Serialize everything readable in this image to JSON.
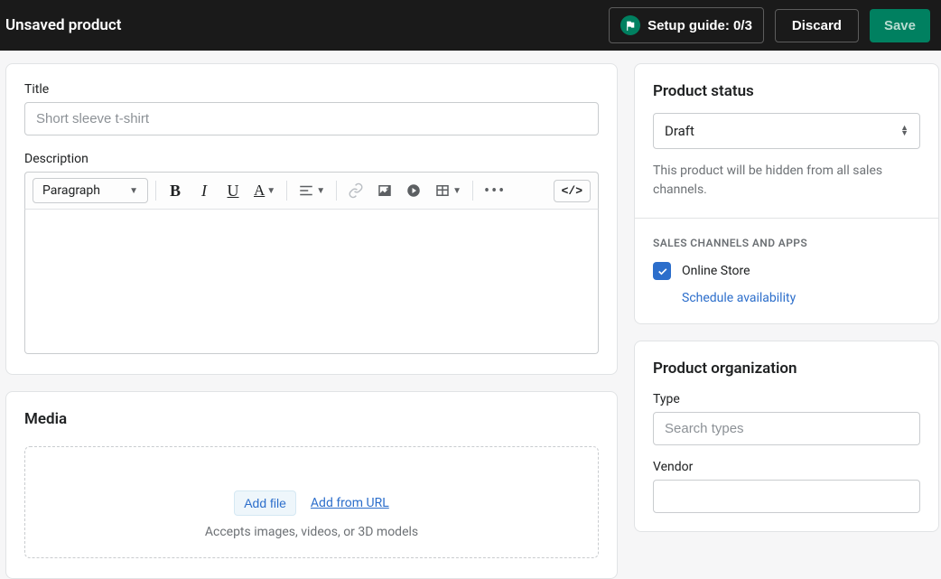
{
  "topbar": {
    "title": "Unsaved product",
    "setup_guide": "Setup guide: 0/3",
    "discard": "Discard",
    "save": "Save"
  },
  "main": {
    "title_label": "Title",
    "title_placeholder": "Short sleeve t-shirt",
    "title_value": "",
    "description_label": "Description",
    "rte": {
      "paragraph": "Paragraph",
      "code": "</>"
    },
    "media": {
      "heading": "Media",
      "add_file": "Add file",
      "add_url": "Add from URL",
      "hint": "Accepts images, videos, or 3D models"
    }
  },
  "side": {
    "status": {
      "heading": "Product status",
      "value": "Draft",
      "hint": "This product will be hidden from all sales channels."
    },
    "channels": {
      "heading": "SALES CHANNELS AND APPS",
      "online_store": "Online Store",
      "schedule": "Schedule availability"
    },
    "organization": {
      "heading": "Product organization",
      "type_label": "Type",
      "type_placeholder": "Search types",
      "vendor_label": "Vendor"
    }
  }
}
